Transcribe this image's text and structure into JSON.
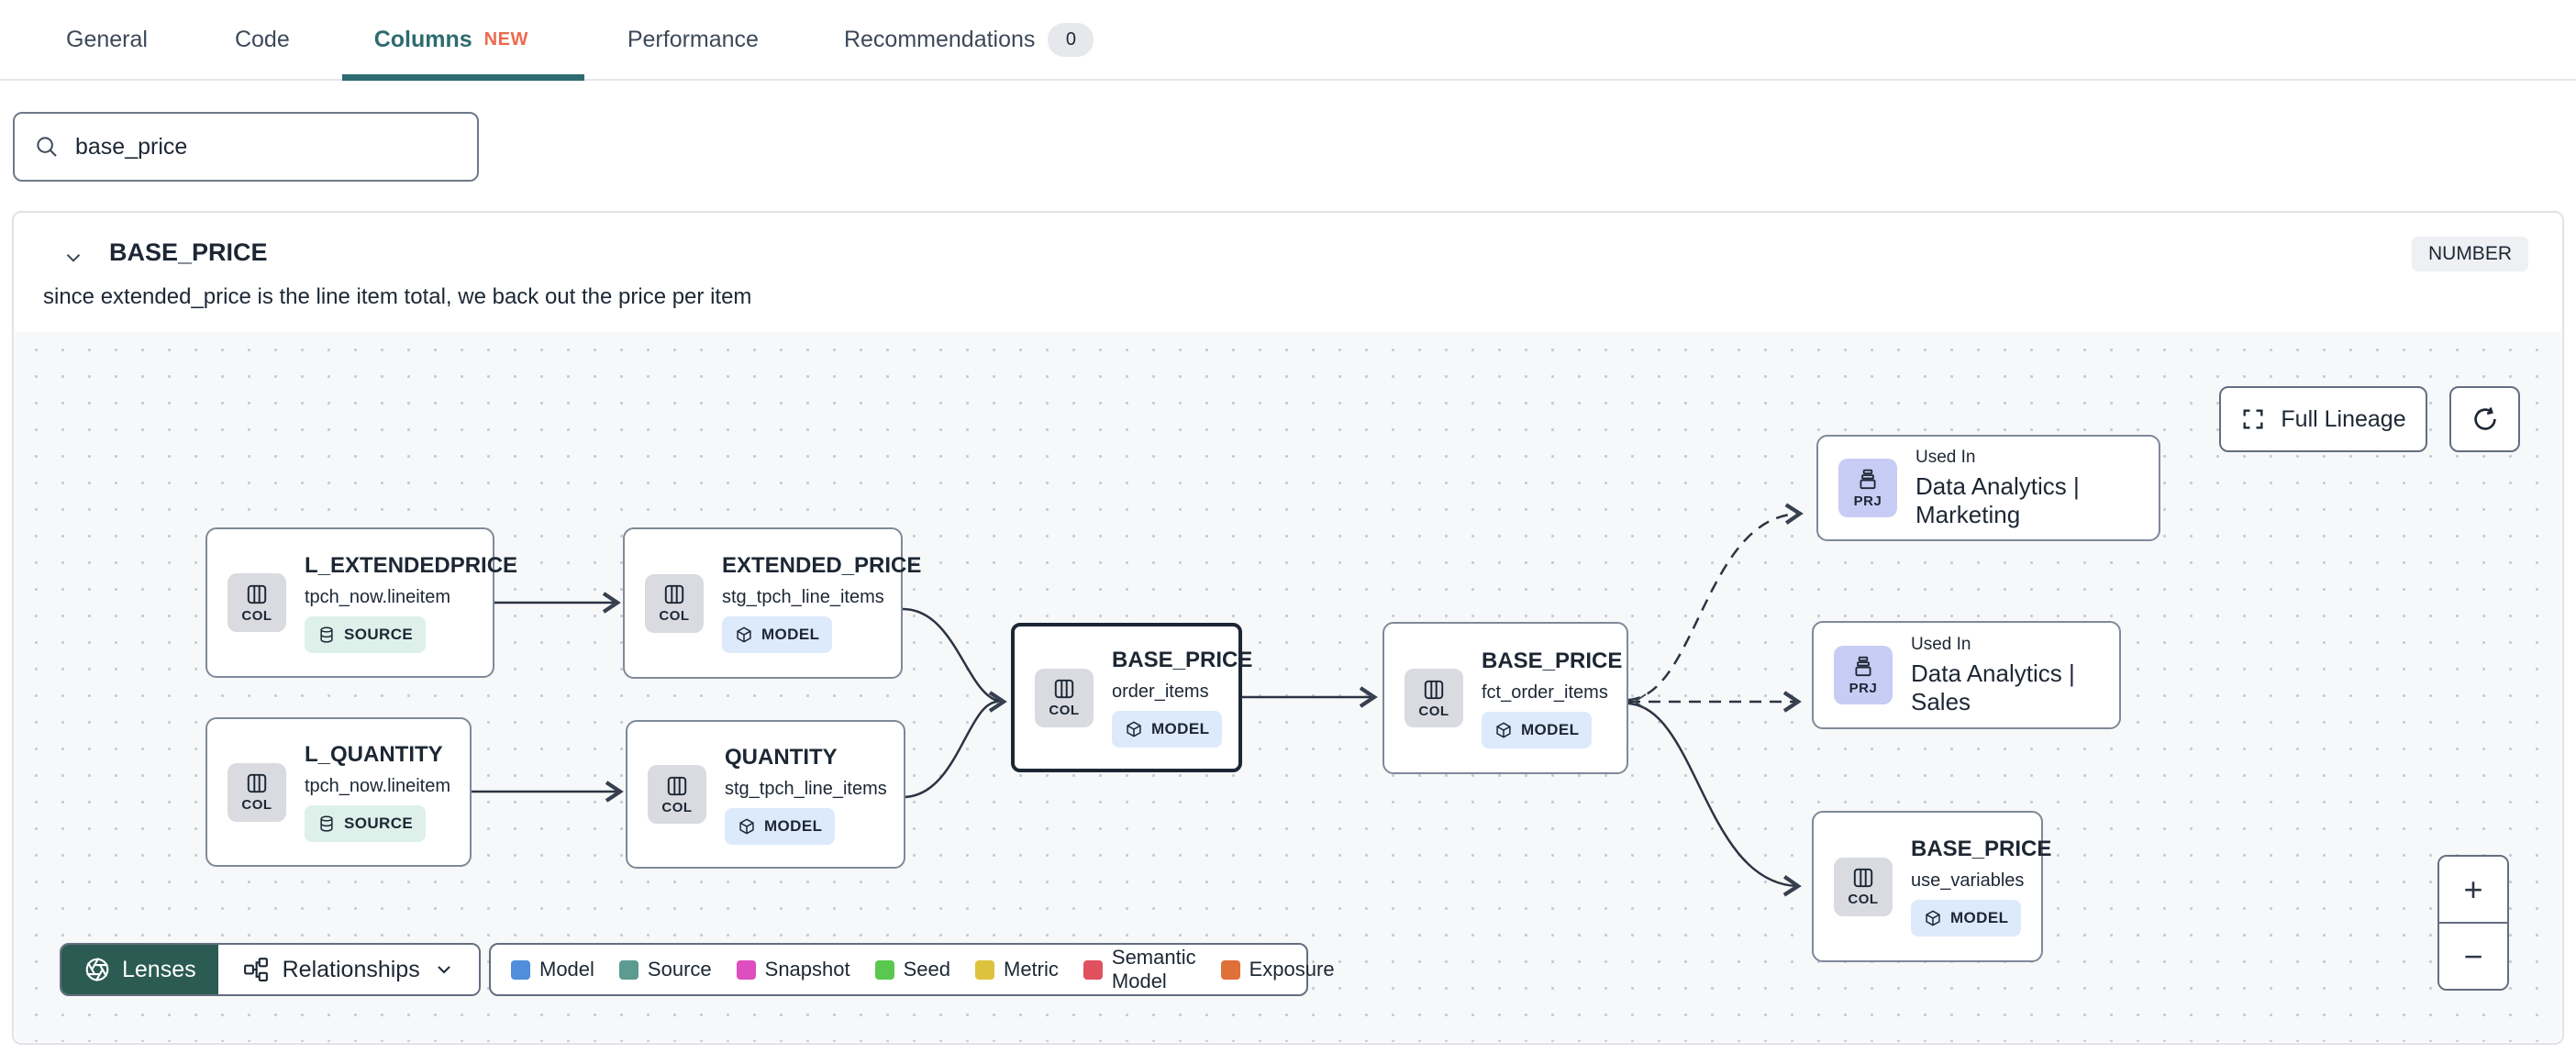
{
  "tabs": {
    "items": [
      {
        "label": "General"
      },
      {
        "label": "Code"
      },
      {
        "label": "Columns",
        "badge": "NEW",
        "active": true
      },
      {
        "label": "Performance"
      },
      {
        "label": "Recommendations",
        "count": "0"
      }
    ]
  },
  "search": {
    "value": "base_price"
  },
  "column_panel": {
    "name": "BASE_PRICE",
    "type_badge": "NUMBER",
    "description": "since extended_price is the line item total, we back out the price per item"
  },
  "lineage": {
    "controls": {
      "full_lineage_label": "Full Lineage",
      "zoom_in": "+",
      "zoom_out": "−"
    },
    "nodes": [
      {
        "chip": "COL",
        "title": "L_EXTENDEDPRICE",
        "subtitle": "tpch_now.lineitem",
        "badge": "SOURCE"
      },
      {
        "chip": "COL",
        "title": "L_QUANTITY",
        "subtitle": "tpch_now.lineitem",
        "badge": "SOURCE"
      },
      {
        "chip": "COL",
        "title": "EXTENDED_PRICE",
        "subtitle": "stg_tpch_line_items",
        "badge": "MODEL"
      },
      {
        "chip": "COL",
        "title": "QUANTITY",
        "subtitle": "stg_tpch_line_items",
        "badge": "MODEL"
      },
      {
        "chip": "COL",
        "title": "BASE_PRICE",
        "subtitle": "order_items",
        "badge": "MODEL",
        "selected": true
      },
      {
        "chip": "COL",
        "title": "BASE_PRICE",
        "subtitle": "fct_order_items",
        "badge": "MODEL"
      },
      {
        "chip": "PRJ",
        "kicker": "Used In",
        "title": "Data Analytics | Marketing"
      },
      {
        "chip": "PRJ",
        "kicker": "Used In",
        "title": "Data Analytics | Sales"
      },
      {
        "chip": "COL",
        "title": "BASE_PRICE",
        "subtitle": "use_variables",
        "badge": "MODEL"
      }
    ],
    "footer": {
      "lenses_label": "Lenses",
      "relationships_label": "Relationships"
    },
    "legend": {
      "items": [
        {
          "label": "Model",
          "color": "#4e8edb"
        },
        {
          "label": "Source",
          "color": "#5d9a91"
        },
        {
          "label": "Snapshot",
          "color": "#de4ebf"
        },
        {
          "label": "Seed",
          "color": "#5ac84f"
        },
        {
          "label": "Metric",
          "color": "#ddc23d"
        },
        {
          "label": "Semantic Model",
          "color": "#e0515f"
        },
        {
          "label": "Exposure",
          "color": "#de7038"
        }
      ]
    }
  }
}
